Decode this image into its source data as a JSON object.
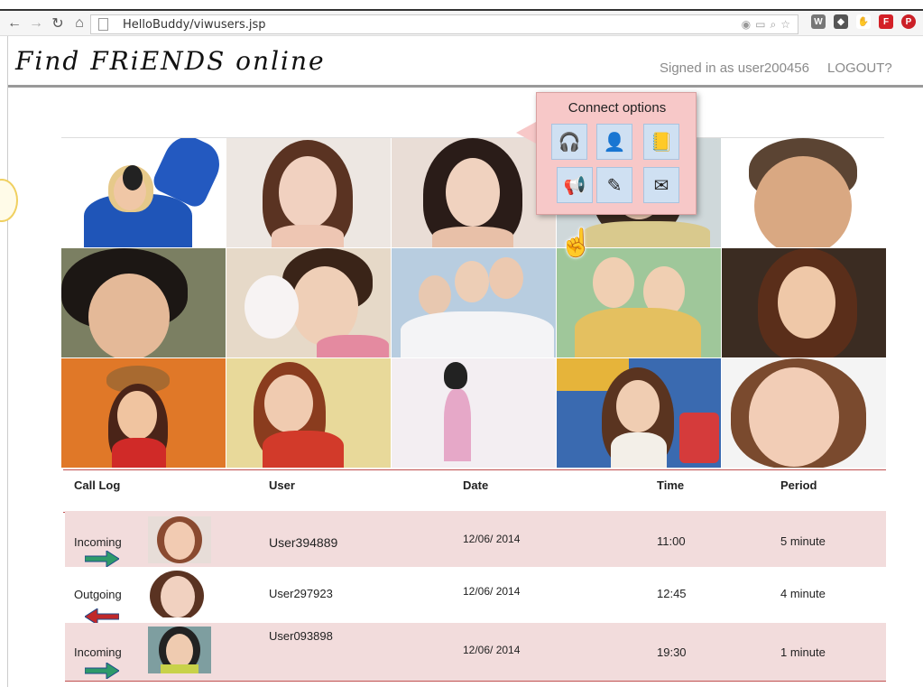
{
  "browser": {
    "url": "HelloBuddy/viwusers.jsp",
    "back_icon": "back-arrow-icon",
    "forward_icon": "forward-arrow-icon",
    "reload_icon": "reload-icon",
    "home_icon": "home-icon"
  },
  "header": {
    "logo": "Find FRiENDS online",
    "signed_in": "Signed in as user200456",
    "logout": "LOGOUT?"
  },
  "connect_popup": {
    "title": "Connect options",
    "options": [
      "headphones-icon",
      "user-card-icon",
      "address-book-icon",
      "megaphone-icon",
      "pen-icon",
      "phone-mail-icon"
    ]
  },
  "call_log": {
    "headers": {
      "call_log": "Call Log",
      "user": "User",
      "date": "Date",
      "time": "Time",
      "period": "Period"
    },
    "rows": [
      {
        "direction": "Incoming",
        "user": "User394889",
        "date": "12/06/ 2014",
        "time": "11:00",
        "period": "5 minute",
        "arrow_color": "#2e9a6a"
      },
      {
        "direction": "Outgoing",
        "user": "User297923",
        "date": "12/06/ 2014",
        "time": "12:45",
        "period": "4 minute",
        "arrow_color": "#c0282a"
      },
      {
        "direction": "Incoming",
        "user": "User093898",
        "date": "12/06/ 2014",
        "time": "19:30",
        "period": "1 minute",
        "arrow_color": "#2e9a6a"
      }
    ]
  },
  "colors": {
    "accent_row": "#f2dcdc",
    "popup_bg": "#f7c8c8",
    "divider": "#c05050"
  }
}
